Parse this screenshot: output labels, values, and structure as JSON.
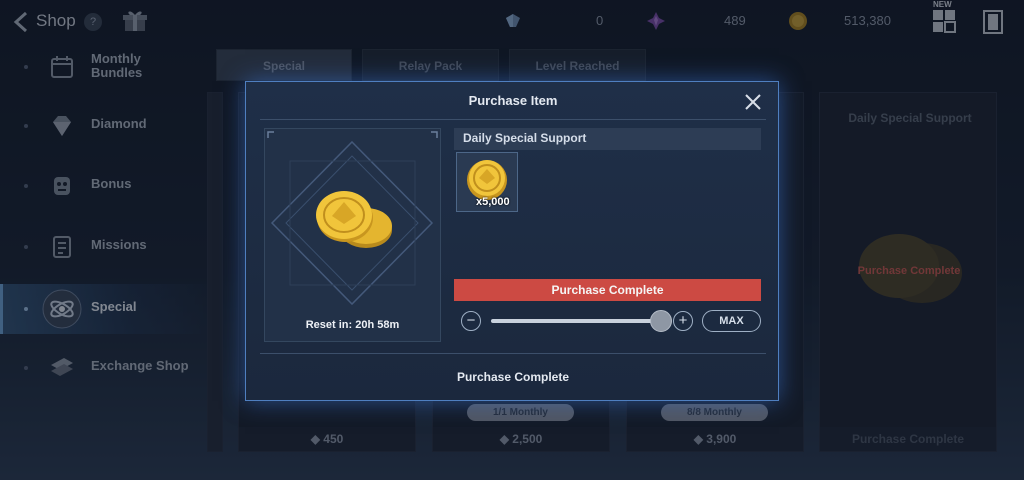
{
  "header": {
    "title": "Shop",
    "help": "?",
    "new_badge": "NEW",
    "currencies": [
      {
        "icon": "crystal-icon",
        "value": "0"
      },
      {
        "icon": "star-gem-icon",
        "value": "489"
      },
      {
        "icon": "gold-coin-icon",
        "value": "513,380"
      }
    ]
  },
  "sidebar": {
    "items": [
      {
        "label": "Monthly\nBundles",
        "icon": "calendar-icon"
      },
      {
        "label": "Diamond",
        "icon": "diamond-icon"
      },
      {
        "label": "Bonus",
        "icon": "bonus-icon"
      },
      {
        "label": "Missions",
        "icon": "checklist-icon"
      },
      {
        "label": "Special",
        "icon": "special-icon",
        "active": true
      },
      {
        "label": "Exchange Shop",
        "icon": "exchange-icon"
      }
    ]
  },
  "tabs": [
    {
      "label": "Special",
      "active": true
    },
    {
      "label": "Relay Pack"
    },
    {
      "label": "Level Reached"
    }
  ],
  "cards": [
    {
      "price": "450"
    },
    {
      "price": "2,500",
      "limit": "1/1 Monthly"
    },
    {
      "price": "3,900",
      "limit": "8/8 Monthly"
    },
    {
      "name": "Daily Special Support",
      "status": "Purchase Complete",
      "footer": "Purchase Complete"
    }
  ],
  "modal": {
    "title": "Purchase Item",
    "reset_text": "Reset in: 20h 58m",
    "pack_name": "Daily Special Support",
    "reward_quantity": "x5,000",
    "status_bar": "Purchase Complete",
    "quantity_fraction": 1.0,
    "minus": "−",
    "plus": "+",
    "max_label": "MAX",
    "footer": "Purchase Complete"
  },
  "colors": {
    "accent": "#4f7fc0",
    "complete_red": "#cc4a43",
    "gold": "#e7b52e"
  }
}
